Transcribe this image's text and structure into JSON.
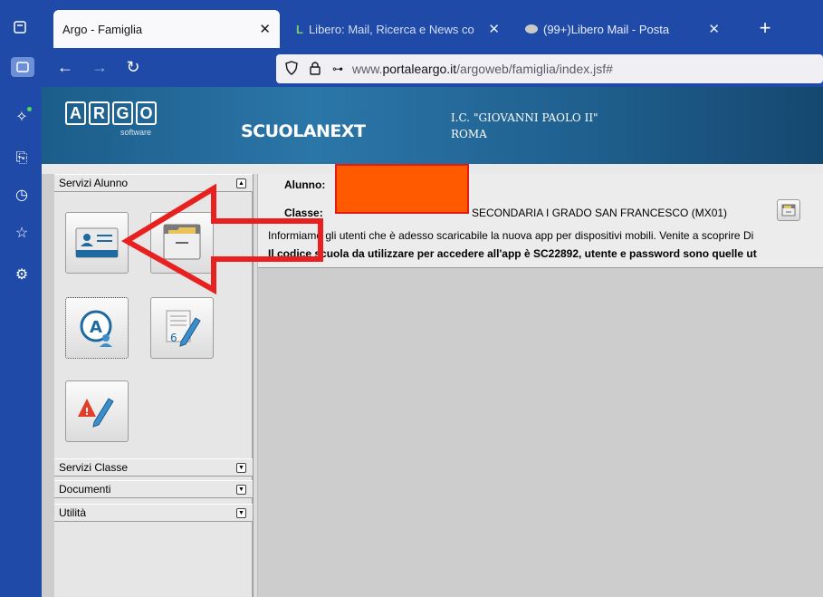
{
  "browser": {
    "tabs": [
      {
        "title": "Argo - Famiglia",
        "active": true
      },
      {
        "title": "Libero: Mail, Ricerca e News co",
        "active": false
      },
      {
        "title": "(99+)Libero Mail - Posta",
        "active": false
      }
    ],
    "new_tab": "+",
    "url_prefix": "www.",
    "url_domain": "portaleargo.it",
    "url_path": "/argoweb/famiglia/index.jsf#"
  },
  "header": {
    "logo_letters": [
      "A",
      "R",
      "G",
      "O"
    ],
    "logo_sub": "software",
    "product": "SCUOLANEXT",
    "school_name": "I.C. \"GIOVANNI PAOLO II\"",
    "school_city": "ROMA"
  },
  "sidebar": {
    "sections": [
      {
        "label": "Servizi Alunno",
        "expanded": true
      },
      {
        "label": "Servizi Classe",
        "expanded": false
      },
      {
        "label": "Documenti",
        "expanded": false
      },
      {
        "label": "Utilità",
        "expanded": false
      }
    ],
    "icon_buttons": [
      "student-card-icon",
      "archive-folder-icon",
      "user-a-icon",
      "grade-pencil-icon",
      "alert-pencil-icon"
    ]
  },
  "student": {
    "alunno_label": "Alunno:",
    "classe_label": "Classe:",
    "classe_value": "SECONDARIA I GRADO SAN FRANCESCO (MX01)"
  },
  "notice": {
    "line1": "Informiamo gli utenti che è adesso scaricabile la nuova app per dispositivi mobili. Venite a scoprire Di",
    "line2": "Il codice scuola da utilizzare per accedere all'app è SC22892, utente e password sono quelle ut"
  },
  "colors": {
    "browser_chrome": "#1f4aa8",
    "annotation_arrow": "#e82020",
    "redaction": "#ff5a00"
  }
}
